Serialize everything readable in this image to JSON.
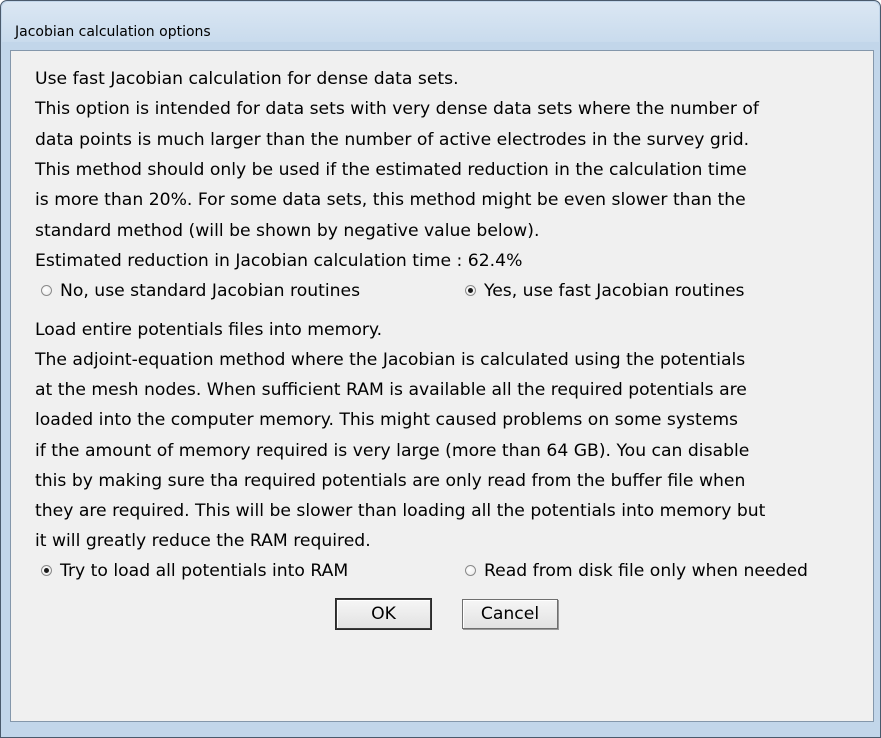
{
  "window": {
    "title": "Jacobian calculation options"
  },
  "section1": {
    "lines": [
      "Use fast Jacobian calculation for dense data sets.",
      "This option is intended for data sets with very dense data sets where the number of",
      "data points is much larger than the number of active electrodes in the survey grid.",
      "This method should only be used if the estimated reduction in the calculation time",
      "is more than 20%. For some data sets, this method might be even slower than the",
      "standard method (will be shown by negative value below).",
      "Estimated reduction in Jacobian calculation time : 62.4%"
    ],
    "options": [
      {
        "label": "No, use standard Jacobian routines",
        "selected": false
      },
      {
        "label": "Yes, use fast Jacobian routines",
        "selected": true
      }
    ]
  },
  "section2": {
    "lines": [
      "Load entire potentials files into memory.",
      "The adjoint-equation method where the Jacobian is calculated using the potentials",
      "at the mesh nodes. When sufficient RAM is available all the required potentials are",
      "loaded into the computer memory. This might caused problems on some systems",
      "if the amount of memory required is very large (more than 64 GB). You can disable",
      "this by making sure tha required potentials are only read from the buffer file when",
      "they are required. This will be slower than loading all the potentials into memory but",
      "it will greatly reduce the RAM required."
    ],
    "options": [
      {
        "label": "Try to load all potentials into RAM",
        "selected": true
      },
      {
        "label": "Read from disk file only when needed",
        "selected": false
      }
    ]
  },
  "buttons": {
    "ok": "OK",
    "cancel": "Cancel"
  },
  "colors": {
    "frame": "#c2d6ea",
    "client_bg": "#f0f0f0",
    "border": "#8497ab"
  }
}
